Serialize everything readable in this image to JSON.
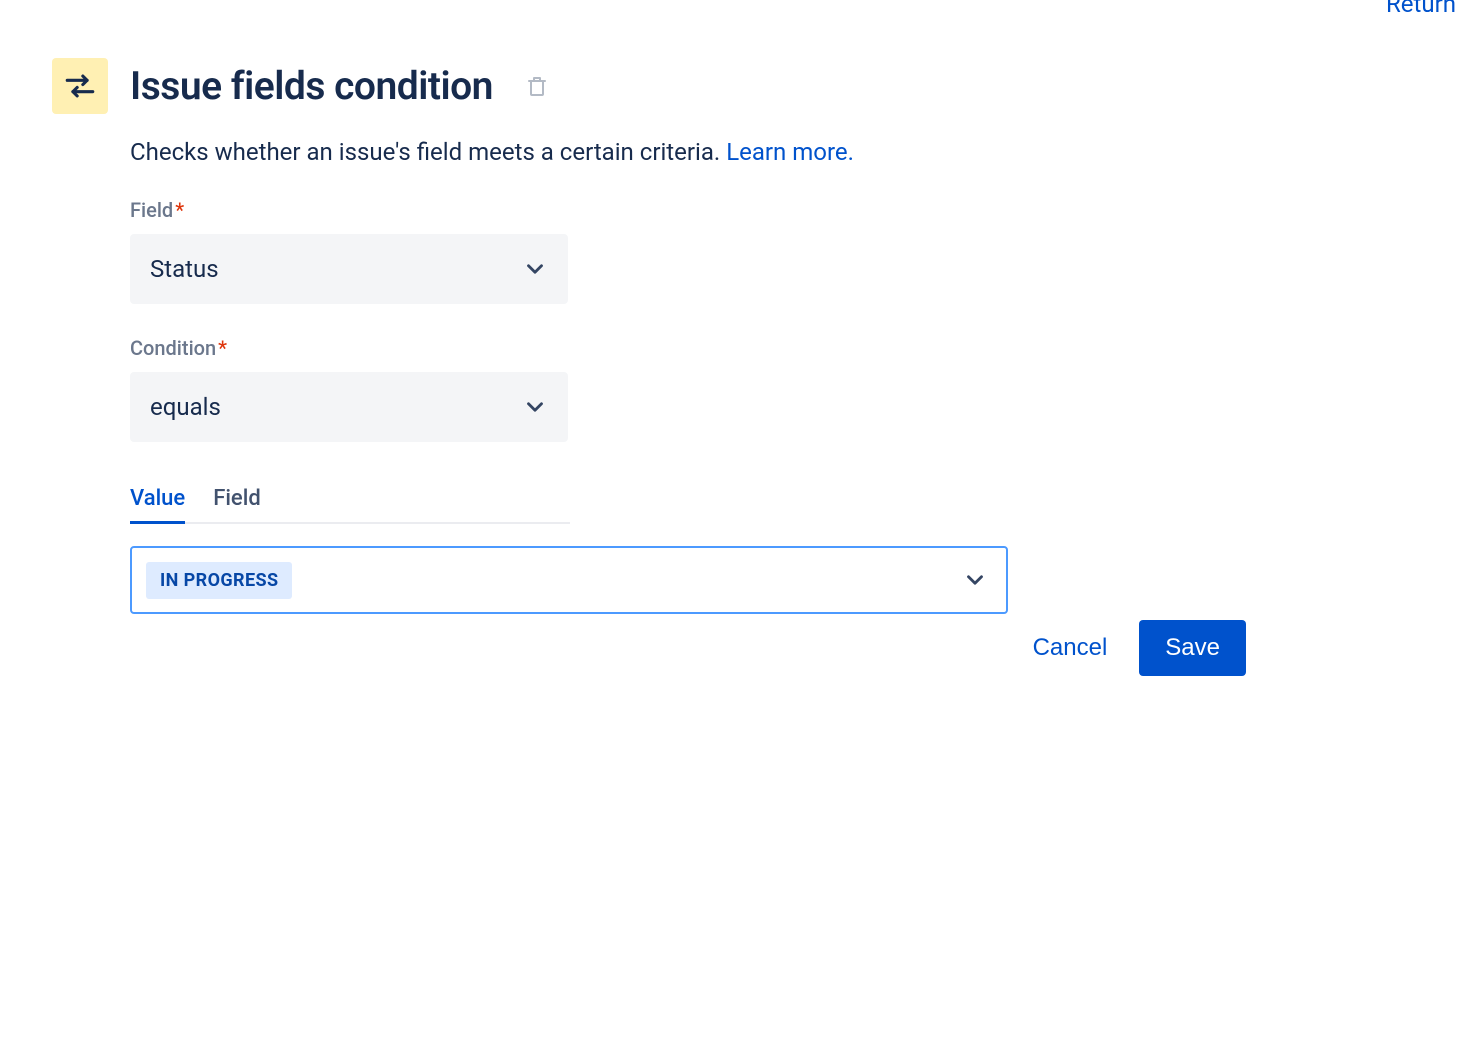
{
  "topLink": "Return",
  "header": {
    "title": "Issue fields condition"
  },
  "description": {
    "text": "Checks whether an issue's field meets a certain criteria. ",
    "learnMore": "Learn more."
  },
  "fields": {
    "field": {
      "label": "Field",
      "value": "Status"
    },
    "condition": {
      "label": "Condition",
      "value": "equals"
    }
  },
  "tabs": {
    "value": "Value",
    "field": "Field",
    "active": "value"
  },
  "valueSelect": {
    "tag": "IN PROGRESS"
  },
  "actions": {
    "cancel": "Cancel",
    "save": "Save"
  },
  "requiredMark": "*"
}
